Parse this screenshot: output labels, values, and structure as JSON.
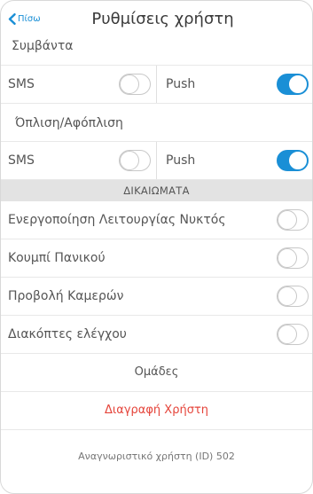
{
  "nav": {
    "back_label": "Πίσω",
    "title": "Ρυθμίσεις χρήστη"
  },
  "events": {
    "label": "Συμβάντα",
    "sms_label": "SMS",
    "sms_on": false,
    "push_label": "Push",
    "push_on": true
  },
  "arming": {
    "label": "Όπλιση/Αφόπλιση",
    "sms_label": "SMS",
    "sms_on": false,
    "push_label": "Push",
    "push_on": true
  },
  "permissions": {
    "header": "ΔΙΚΑΙΩΜΑΤΑ",
    "items": [
      {
        "label": "Ενεργοποίηση Λειτουργίας Νυκτός",
        "on": false
      },
      {
        "label": "Κουμπί Πανικού",
        "on": false
      },
      {
        "label": "Προβολή Καμερών",
        "on": false
      },
      {
        "label": "Διακόπτες ελέγχου",
        "on": false
      }
    ]
  },
  "actions": {
    "groups_label": "Ομάδες",
    "delete_label": "Διαγραφή Χρήστη"
  },
  "footer": {
    "user_id_text": "Αναγνωριστικό χρήστη (ID) 502"
  },
  "colors": {
    "accent": "#1a8fd6",
    "danger": "#e5443a",
    "section_bg": "#e3e3e3"
  }
}
